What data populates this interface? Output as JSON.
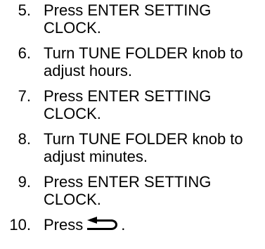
{
  "steps": [
    {
      "number": "5.",
      "text": "Press ENTER SETTING CLOCK."
    },
    {
      "number": "6.",
      "text": "Turn TUNE FOLDER knob to adjust hours."
    },
    {
      "number": "7.",
      "text": "Press ENTER SETTING CLOCK."
    },
    {
      "number": "8.",
      "text": "Turn TUNE FOLDER knob to adjust minutes."
    },
    {
      "number": "9.",
      "text": "Press ENTER SETTING CLOCK."
    },
    {
      "number": "10.",
      "text": "Press",
      "icon": "back-arrow-icon",
      "suffix": "."
    }
  ]
}
